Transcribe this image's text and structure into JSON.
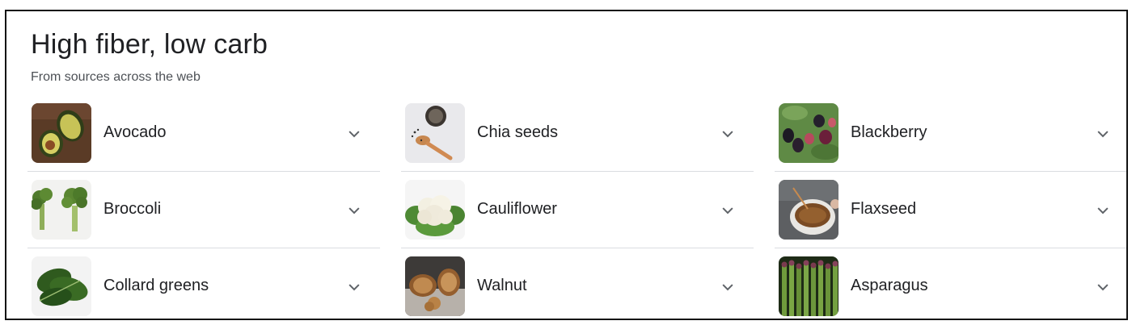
{
  "header": {
    "title": "High fiber, low carb",
    "subtitle": "From sources across the web"
  },
  "items": [
    {
      "label": "Avocado",
      "icon": "avocado-image"
    },
    {
      "label": "Chia seeds",
      "icon": "chia-seeds-image"
    },
    {
      "label": "Blackberry",
      "icon": "blackberry-image"
    },
    {
      "label": "Broccoli",
      "icon": "broccoli-image"
    },
    {
      "label": "Cauliflower",
      "icon": "cauliflower-image"
    },
    {
      "label": "Flaxseed",
      "icon": "flaxseed-image"
    },
    {
      "label": "Collard greens",
      "icon": "collard-greens-image"
    },
    {
      "label": "Walnut",
      "icon": "walnut-image"
    },
    {
      "label": "Asparagus",
      "icon": "asparagus-image"
    }
  ],
  "colors": {
    "text": "#202124",
    "subtext": "#4d5156",
    "divider": "#dadce0",
    "chevron": "#5f6368"
  }
}
